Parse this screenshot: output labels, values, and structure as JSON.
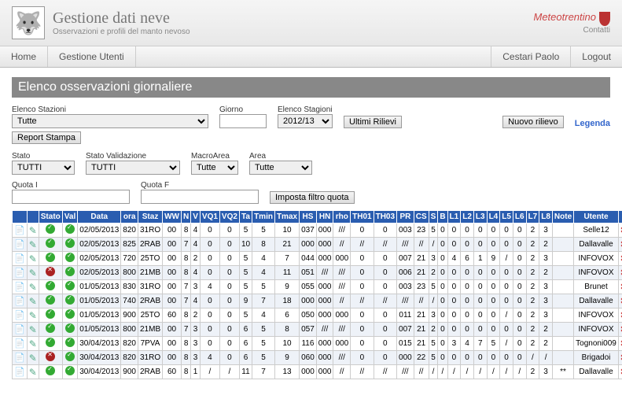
{
  "header": {
    "title": "Gestione dati neve",
    "subtitle": "Osservazioni e profili del manto nevoso",
    "brand": "Meteotrentino",
    "contatti": "Contatti"
  },
  "menu": {
    "home": "Home",
    "utenti": "Gestione Utenti",
    "user": "Cestari Paolo",
    "logout": "Logout"
  },
  "page": {
    "title": "Elenco osservazioni giornaliere"
  },
  "filters": {
    "stazioni_lbl": "Elenco Stazioni",
    "stazioni_val": "Tutte",
    "giorno_lbl": "Giorno",
    "giorno_val": "",
    "stagioni_lbl": "Elenco Stagioni",
    "stagioni_val": "2012/13",
    "ultimi": "Ultimi Rilievi",
    "nuovo": "Nuovo rilievo",
    "legenda": "Legenda",
    "report": "Report Stampa",
    "stato_lbl": "Stato",
    "stato_val": "TUTTI",
    "statoval_lbl": "Stato Validazione",
    "statoval_val": "TUTTI",
    "macro_lbl": "MacroArea",
    "macro_val": "Tutte",
    "area_lbl": "Area",
    "area_val": "Tutte",
    "quotai_lbl": "Quota I",
    "quotai_val": "",
    "quotaf_lbl": "Quota F",
    "quotaf_val": "",
    "imposta": "Imposta filtro quota"
  },
  "cols": [
    "",
    "",
    "Stato",
    "Val",
    "Data",
    "ora",
    "Staz",
    "WW",
    "N",
    "V",
    "VQ1",
    "VQ2",
    "Ta",
    "Tmin",
    "Tmax",
    "HS",
    "HN",
    "rho",
    "TH01",
    "TH03",
    "PR",
    "CS",
    "S",
    "B",
    "L1",
    "L2",
    "L3",
    "L4",
    "L5",
    "L6",
    "L7",
    "L8",
    "Note",
    "Utente",
    ""
  ],
  "rows": [
    {
      "st": "ok",
      "val": "ok",
      "data": "02/05/2013",
      "ora": "820",
      "staz": "31RO",
      "ww": "00",
      "n": "8",
      "v": "4",
      "vq1": "0",
      "vq2": "0",
      "ta": "5",
      "tmin": "5",
      "tmax": "10",
      "hs": "037",
      "hn": "000",
      "rho": "///",
      "th01": "0",
      "th03": "0",
      "pr": "003",
      "cs": "23",
      "s": "5",
      "b": "0",
      "l1": "0",
      "l2": "0",
      "l3": "0",
      "l4": "0",
      "l5": "0",
      "l6": "0",
      "l7": "2",
      "l8": "3",
      "note": "",
      "utente": "Selle12"
    },
    {
      "st": "ok",
      "val": "ok",
      "data": "02/05/2013",
      "ora": "825",
      "staz": "2RAB",
      "ww": "00",
      "n": "7",
      "v": "4",
      "vq1": "0",
      "vq2": "0",
      "ta": "10",
      "tmin": "8",
      "tmax": "21",
      "hs": "000",
      "hn": "000",
      "rho": "//",
      "th01": "//",
      "th03": "//",
      "pr": "///",
      "cs": "//",
      "s": "/",
      "b": "0",
      "l1": "0",
      "l2": "0",
      "l3": "0",
      "l4": "0",
      "l5": "0",
      "l6": "0",
      "l7": "2",
      "l8": "2",
      "note": "",
      "utente": "Dallavalle"
    },
    {
      "st": "ok",
      "val": "ok",
      "data": "02/05/2013",
      "ora": "720",
      "staz": "25TO",
      "ww": "00",
      "n": "8",
      "v": "2",
      "vq1": "0",
      "vq2": "0",
      "ta": "5",
      "tmin": "4",
      "tmax": "7",
      "hs": "044",
      "hn": "000",
      "rho": "000",
      "th01": "0",
      "th03": "0",
      "pr": "007",
      "cs": "21",
      "s": "3",
      "b": "0",
      "l1": "4",
      "l2": "6",
      "l3": "1",
      "l4": "9",
      "l5": "/",
      "l6": "0",
      "l7": "2",
      "l8": "3",
      "note": "",
      "utente": "INFOVOX"
    },
    {
      "st": "no",
      "val": "ok",
      "data": "02/05/2013",
      "ora": "800",
      "staz": "21MB",
      "ww": "00",
      "n": "8",
      "v": "4",
      "vq1": "0",
      "vq2": "0",
      "ta": "5",
      "tmin": "4",
      "tmax": "11",
      "hs": "051",
      "hn": "///",
      "rho": "///",
      "th01": "0",
      "th03": "0",
      "pr": "006",
      "cs": "21",
      "s": "2",
      "b": "0",
      "l1": "0",
      "l2": "0",
      "l3": "0",
      "l4": "0",
      "l5": "0",
      "l6": "0",
      "l7": "2",
      "l8": "2",
      "note": "",
      "utente": "INFOVOX"
    },
    {
      "st": "ok",
      "val": "ok",
      "data": "01/05/2013",
      "ora": "830",
      "staz": "31RO",
      "ww": "00",
      "n": "7",
      "v": "3",
      "vq1": "4",
      "vq2": "0",
      "ta": "5",
      "tmin": "5",
      "tmax": "9",
      "hs": "055",
      "hn": "000",
      "rho": "///",
      "th01": "0",
      "th03": "0",
      "pr": "003",
      "cs": "23",
      "s": "5",
      "b": "0",
      "l1": "0",
      "l2": "0",
      "l3": "0",
      "l4": "0",
      "l5": "0",
      "l6": "0",
      "l7": "2",
      "l8": "3",
      "note": "",
      "utente": "Brunet"
    },
    {
      "st": "ok",
      "val": "ok",
      "data": "01/05/2013",
      "ora": "740",
      "staz": "2RAB",
      "ww": "00",
      "n": "7",
      "v": "4",
      "vq1": "0",
      "vq2": "0",
      "ta": "9",
      "tmin": "7",
      "tmax": "18",
      "hs": "000",
      "hn": "000",
      "rho": "//",
      "th01": "//",
      "th03": "//",
      "pr": "///",
      "cs": "//",
      "s": "/",
      "b": "0",
      "l1": "0",
      "l2": "0",
      "l3": "0",
      "l4": "0",
      "l5": "0",
      "l6": "0",
      "l7": "2",
      "l8": "3",
      "note": "",
      "utente": "Dallavalle"
    },
    {
      "st": "ok",
      "val": "ok",
      "data": "01/05/2013",
      "ora": "900",
      "staz": "25TO",
      "ww": "60",
      "n": "8",
      "v": "2",
      "vq1": "0",
      "vq2": "0",
      "ta": "5",
      "tmin": "4",
      "tmax": "6",
      "hs": "050",
      "hn": "000",
      "rho": "000",
      "th01": "0",
      "th03": "0",
      "pr": "011",
      "cs": "21",
      "s": "3",
      "b": "0",
      "l1": "0",
      "l2": "0",
      "l3": "0",
      "l4": "0",
      "l5": "/",
      "l6": "0",
      "l7": "2",
      "l8": "3",
      "note": "",
      "utente": "INFOVOX"
    },
    {
      "st": "ok",
      "val": "ok",
      "data": "01/05/2013",
      "ora": "800",
      "staz": "21MB",
      "ww": "00",
      "n": "7",
      "v": "3",
      "vq1": "0",
      "vq2": "0",
      "ta": "6",
      "tmin": "5",
      "tmax": "8",
      "hs": "057",
      "hn": "///",
      "rho": "///",
      "th01": "0",
      "th03": "0",
      "pr": "007",
      "cs": "21",
      "s": "2",
      "b": "0",
      "l1": "0",
      "l2": "0",
      "l3": "0",
      "l4": "0",
      "l5": "0",
      "l6": "0",
      "l7": "2",
      "l8": "2",
      "note": "",
      "utente": "INFOVOX"
    },
    {
      "st": "ok",
      "val": "ok",
      "data": "30/04/2013",
      "ora": "820",
      "staz": "7PVA",
      "ww": "00",
      "n": "8",
      "v": "3",
      "vq1": "0",
      "vq2": "0",
      "ta": "6",
      "tmin": "5",
      "tmax": "10",
      "hs": "116",
      "hn": "000",
      "rho": "000",
      "th01": "0",
      "th03": "0",
      "pr": "015",
      "cs": "21",
      "s": "5",
      "b": "0",
      "l1": "3",
      "l2": "4",
      "l3": "7",
      "l4": "5",
      "l5": "/",
      "l6": "0",
      "l7": "2",
      "l8": "2",
      "note": "",
      "utente": "Tognoni009"
    },
    {
      "st": "no",
      "val": "ok",
      "data": "30/04/2013",
      "ora": "820",
      "staz": "31RO",
      "ww": "00",
      "n": "8",
      "v": "3",
      "vq1": "4",
      "vq2": "0",
      "ta": "6",
      "tmin": "5",
      "tmax": "9",
      "hs": "060",
      "hn": "000",
      "rho": "///",
      "th01": "0",
      "th03": "0",
      "pr": "000",
      "cs": "22",
      "s": "5",
      "b": "0",
      "l1": "0",
      "l2": "0",
      "l3": "0",
      "l4": "0",
      "l5": "0",
      "l6": "0",
      "l7": "/",
      "l8": "/",
      "note": "",
      "utente": "Brigadoi"
    },
    {
      "st": "ok",
      "val": "ok",
      "data": "30/04/2013",
      "ora": "900",
      "staz": "2RAB",
      "ww": "60",
      "n": "8",
      "v": "1",
      "vq1": "/",
      "vq2": "/",
      "ta": "11",
      "tmin": "7",
      "tmax": "13",
      "hs": "000",
      "hn": "000",
      "rho": "//",
      "th01": "//",
      "th03": "//",
      "pr": "///",
      "cs": "//",
      "s": "/",
      "b": "/",
      "l1": "/",
      "l2": "/",
      "l3": "/",
      "l4": "/",
      "l5": "/",
      "l6": "/",
      "l7": "2",
      "l8": "3",
      "note": "**",
      "utente": "Dallavalle"
    }
  ]
}
